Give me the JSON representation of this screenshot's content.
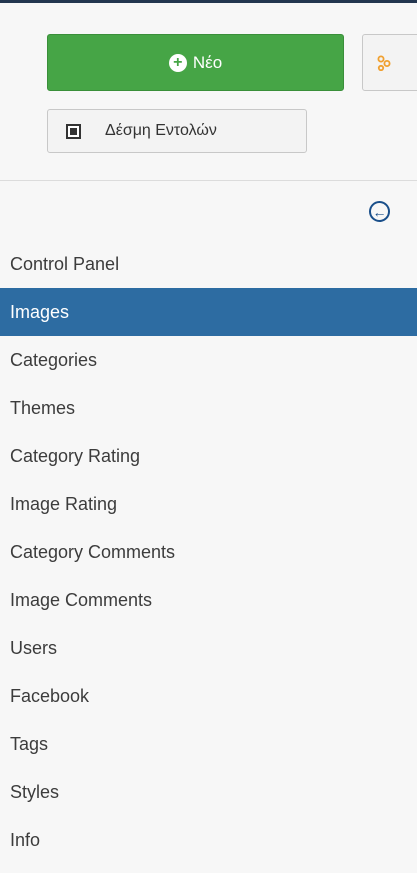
{
  "toolbar": {
    "new_label": "Νέο",
    "batch_label": "Δέσμη Εντολών"
  },
  "submenu": {
    "active_index": 1,
    "items": [
      {
        "label": "Control Panel"
      },
      {
        "label": "Images"
      },
      {
        "label": "Categories"
      },
      {
        "label": "Themes"
      },
      {
        "label": "Category Rating"
      },
      {
        "label": "Image Rating"
      },
      {
        "label": "Category Comments"
      },
      {
        "label": "Image Comments"
      },
      {
        "label": "Users"
      },
      {
        "label": "Facebook"
      },
      {
        "label": "Tags"
      },
      {
        "label": "Styles"
      },
      {
        "label": "Info"
      }
    ]
  },
  "colors": {
    "accent_green": "#46a546",
    "active_blue": "#2d6ca2",
    "icon_blue": "#1a4f8a",
    "extra_orange": "#f0a030"
  },
  "icons": {
    "new": "plus-circle-icon",
    "extra": "options-icon",
    "batch": "checkbox-icon",
    "collapse": "arrow-left-circle-icon"
  }
}
